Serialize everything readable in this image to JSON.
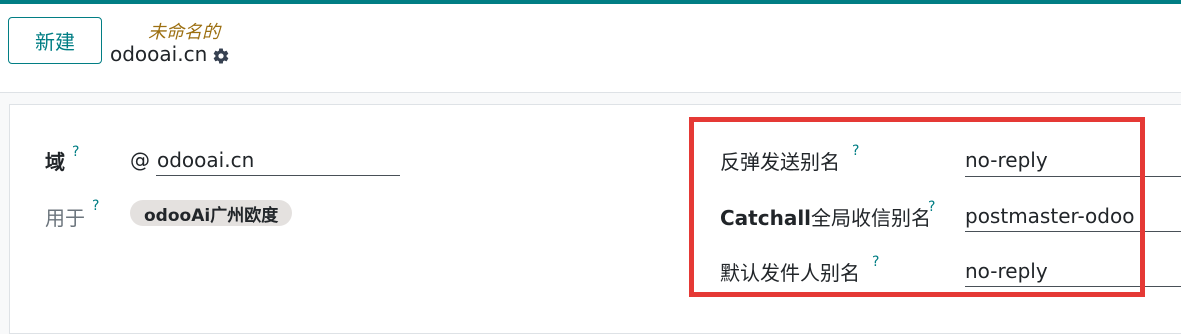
{
  "header": {
    "new_button": "新建",
    "unsaved_status": "未命名的",
    "record_title": "odooai.cn"
  },
  "form": {
    "domain": {
      "label": "域",
      "help": "?",
      "prefix": "@",
      "value": "odooai.cn"
    },
    "used_for": {
      "label": "用于",
      "help": "?",
      "tag": "odooAi广州欧度"
    },
    "bounce_alias": {
      "label": "反弹发送别名",
      "help": "?",
      "value": "no-reply"
    },
    "catchall_alias": {
      "label": "Catchall",
      "label_suffix": "全局收信别名",
      "help": "?",
      "value": "postmaster-odoo"
    },
    "default_from": {
      "label": "默认发件人别名",
      "help": "?",
      "value": "no-reply"
    }
  },
  "colors": {
    "brand": "#017e84",
    "unsaved": "#9c6f11",
    "highlight": "#e53935"
  },
  "icons": {
    "settings": "gear-icon"
  }
}
